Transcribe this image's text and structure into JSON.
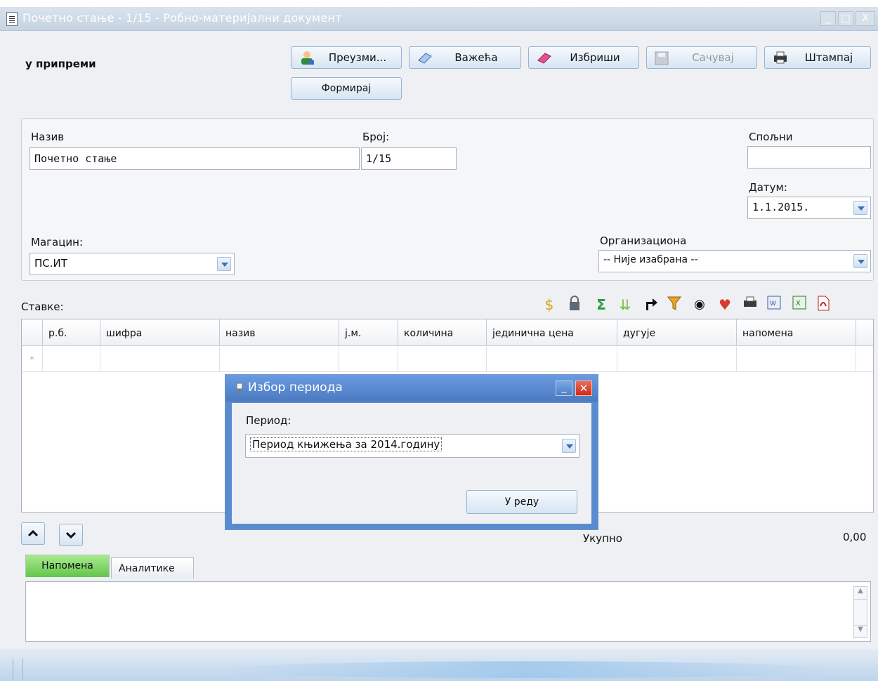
{
  "window": {
    "title": "Почетно стање - 1/15 - Робно-материјални документ"
  },
  "status": "у припреми",
  "toolbar": {
    "take_label": "Преузми...",
    "valid_label": "Важећа",
    "delete_label": "Избриши",
    "save_label": "Сачувај",
    "print_label": "Штампај",
    "form_label": "Формирај"
  },
  "form": {
    "name_label": "Назив",
    "name_value": "Почетно стање",
    "number_label": "Број:",
    "number_value": "1/15",
    "external_label": "Спољни",
    "external_value": "",
    "date_label": "Датум:",
    "date_value": "1.1.2015.",
    "warehouse_label": "Магацин:",
    "warehouse_value": "ПС.ИТ",
    "org_label": "Организациона",
    "org_value": "-- Није изабрана --"
  },
  "items": {
    "label": "Ставке:",
    "columns": [
      "р.б.",
      "шифра",
      "назив",
      "ј.м.",
      "количина",
      "јединична цена",
      "дугује",
      "напомена"
    ],
    "new_row_marker": "*"
  },
  "dialog": {
    "title": "Избор периода",
    "period_label": "Период:",
    "period_value": "Период књижења за 2014.годину",
    "ok_label": "У реду"
  },
  "summary": {
    "total_label": "Укупно",
    "total_value": "0,00"
  },
  "tabs": [
    {
      "label": "Напомена",
      "active": true
    },
    {
      "label": "Аналитике",
      "active": false
    }
  ],
  "icons": [
    "refresh-icon",
    "lock-icon",
    "sum-icon",
    "down-arrows-icon",
    "redirect-icon",
    "filter-icon",
    "eye-icon",
    "heart-icon",
    "print-icon",
    "word-icon",
    "excel-icon",
    "pdf-icon"
  ],
  "colors": {
    "title_bar": "#c5d3e2",
    "dialog_title": "#4b7ac0",
    "active_tab": "#7fd46a"
  }
}
